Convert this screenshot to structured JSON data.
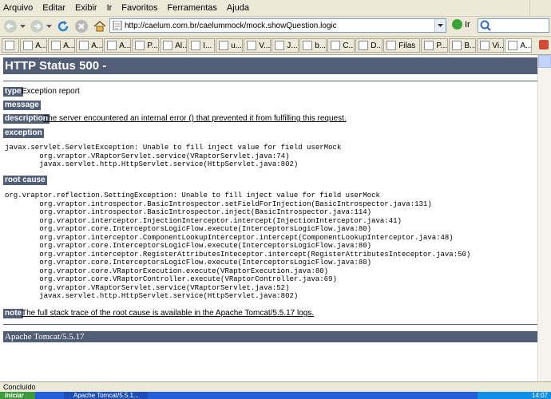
{
  "menu": [
    "Arquivo",
    "Editar",
    "Exibir",
    "Ir",
    "Favoritos",
    "Ferramentas",
    "Ajuda"
  ],
  "toolbar": {
    "url": "http://caelum.com.br/caelummock/mock.showQuestion.logic",
    "go_label": "Ir"
  },
  "tabs": [
    {
      "label": "",
      "active": false
    },
    {
      "label": "A...",
      "active": false
    },
    {
      "label": "A...",
      "active": false
    },
    {
      "label": "A...",
      "active": false
    },
    {
      "label": "A...",
      "active": false
    },
    {
      "label": "P...",
      "active": false
    },
    {
      "label": "Al...",
      "active": false
    },
    {
      "label": "I...",
      "active": false
    },
    {
      "label": "u...",
      "active": false
    },
    {
      "label": "V...",
      "active": false
    },
    {
      "label": "J...",
      "active": false
    },
    {
      "label": "b...",
      "active": false
    },
    {
      "label": "C...",
      "active": false
    },
    {
      "label": "D...",
      "active": false
    },
    {
      "label": "Filas",
      "active": false
    },
    {
      "label": "P...",
      "active": false
    },
    {
      "label": "B...",
      "active": false
    },
    {
      "label": "Vi...",
      "active": false
    },
    {
      "label": "A...",
      "active": true
    }
  ],
  "page": {
    "title": "HTTP Status 500 -",
    "type_label": "type",
    "type_value": "Exception report",
    "message_label": "message",
    "description_label": "description",
    "description_value": "The server encountered an internal error () that prevented it from fulfilling this request.",
    "exception_label": "exception",
    "exception_trace": "javax.servlet.ServletException: Unable to fill inject value for field userMock\n\torg.vraptor.VRaptorServlet.service(VRaptorServlet.java:74)\n\tjavax.servlet.http.HttpServlet.service(HttpServlet.java:802)",
    "root_cause_label": "root cause",
    "root_cause_trace": "org.vraptor.reflection.SettingException: Unable to fill inject value for field userMock\n\torg.vraptor.introspector.BasicIntrospector.setFieldForInjection(BasicIntrospector.java:131)\n\torg.vraptor.introspector.BasicIntrospector.inject(BasicIntrospector.java:114)\n\torg.vraptor.interceptor.InjectionInterceptor.intercept(InjectionInterceptor.java:41)\n\torg.vraptor.core.InterceptorsLogicFlow.execute(InterceptorsLogicFlow.java:80)\n\torg.vraptor.interceptor.ComponentLookupInterceptor.intercept(ComponentLookupInterceptor.java:48)\n\torg.vraptor.core.InterceptorsLogicFlow.execute(InterceptorsLogicFlow.java:80)\n\torg.vraptor.interceptor.RegisterAttributesInteceptor.intercept(RegisterAttributesInteceptor.java:50)\n\torg.vraptor.core.InterceptorsLogicFlow.execute(InterceptorsLogicFlow.java:80)\n\torg.vraptor.core.VRaptorExecution.execute(VRaptorExecution.java:80)\n\torg.vraptor.core.VRaptorController.execute(VRaptorController.java:69)\n\torg.vraptor.VRaptorServlet.service(VRaptorServlet.java:52)\n\tjavax.servlet.http.HttpServlet.service(HttpServlet.java:802)",
    "note_label": "note",
    "note_value": "The full stack trace of the root cause is available in the Apache Tomcat/5.5.17 logs.",
    "footer": "Apache Tomcat/5.5.17"
  },
  "status": "Concluído",
  "taskbar": {
    "start_label": "Iniciar",
    "task_label": "Apache Tomcat/5.5.1...",
    "clock": "14:07"
  }
}
